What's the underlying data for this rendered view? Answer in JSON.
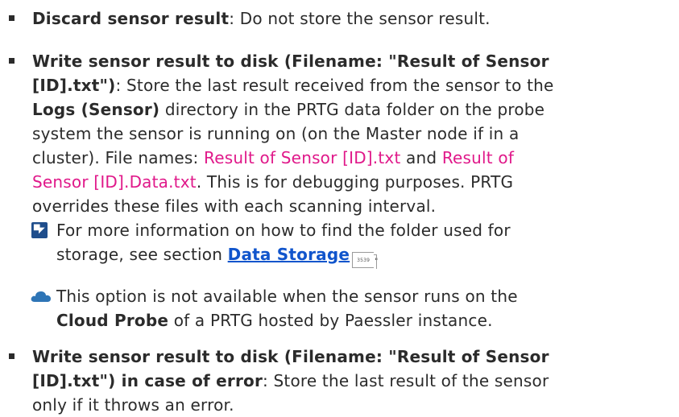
{
  "items": [
    {
      "term": "Discard sensor result",
      "desc": ": Do not store the sensor result."
    },
    {
      "term_line1": "Write sensor result to disk (Filename: \"Result of Sensor",
      "term_line2": "[ID].txt\")",
      "desc_a": ": Store the last result received from the sensor to the",
      "logs_dir": "Logs (Sensor)",
      "desc_b": " directory in the PRTG data folder on the probe",
      "desc_c": "system the sensor is running on (on the Master node if in a",
      "desc_d": "cluster). File names: ",
      "file1": "Result of Sensor [ID].txt",
      "and_text": " and ",
      "file2_part1": "Result of",
      "file2_part2": "Sensor [ID].Data.txt",
      "desc_e": ". This is for debugging purposes. PRTG",
      "desc_f": "overrides these files with each scanning interval.",
      "note_line1": "For more information on how to find the folder used for",
      "note_line2_prefix": "storage, see section ",
      "note_link": "Data Storage",
      "note_page": "3539",
      "note_suffix": "."
    },
    {
      "term_line1": "Write sensor result to disk (Filename: \"Result of Sensor",
      "term_line2": "[ID].txt\") in case of error",
      "desc_a": ": Store the last result of the sensor",
      "desc_b": "only if it throws an error."
    }
  ],
  "cloud_note": {
    "line1": "This option is not available when the sensor runs on the",
    "bold": "Cloud Probe",
    "line2_suffix": " of a PRTG hosted by Paessler instance."
  },
  "icons": {
    "note": "book-reference-icon",
    "cloud": "cloud-icon",
    "bullet": "square-bullet-icon"
  },
  "colors": {
    "text": "#2b2b2b",
    "filename": "#e0198a",
    "link": "#1155cc",
    "note_icon": "#1f4e8c",
    "cloud_icon": "#2e75b6"
  }
}
